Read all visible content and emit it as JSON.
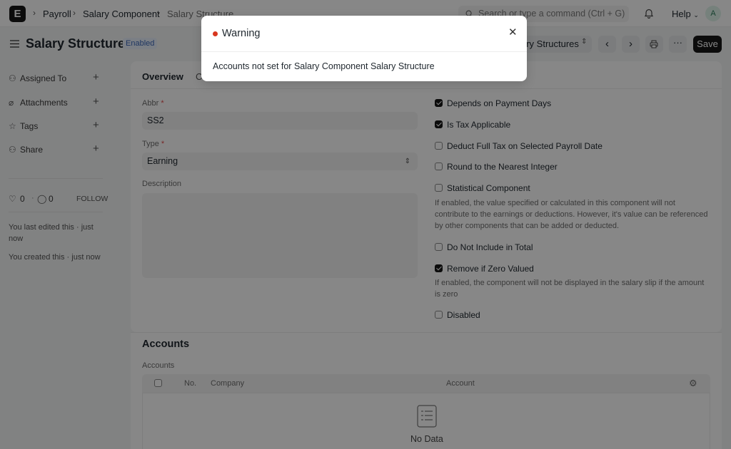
{
  "navbar": {
    "logo": "E",
    "breadcrumbs": [
      "Payroll",
      "Salary Component",
      "Salary Structure"
    ],
    "search_placeholder": "Search or type a command (Ctrl + G)",
    "help_label": "Help",
    "avatar_letter": "A"
  },
  "page": {
    "title": "Salary Structure",
    "status": "Enabled",
    "view_switch_label": "ary Structures",
    "save_label": "Save"
  },
  "sidebar": {
    "items": [
      {
        "label": "Assigned To"
      },
      {
        "label": "Attachments"
      },
      {
        "label": "Tags"
      },
      {
        "label": "Share"
      }
    ],
    "likes": "0",
    "comments": "0",
    "follow_label": "FOLLOW",
    "last_edited": "You last edited this · just now",
    "created": "You created this · just now"
  },
  "tabs": [
    "Overview",
    "C"
  ],
  "form": {
    "abbr_label": "Abbr",
    "abbr_value": "SS2",
    "type_label": "Type",
    "type_value": "Earning",
    "description_label": "Description",
    "checkboxes": [
      {
        "label": "Depends on Payment Days",
        "checked": true
      },
      {
        "label": "Is Tax Applicable",
        "checked": true
      },
      {
        "label": "Deduct Full Tax on Selected Payroll Date",
        "checked": false
      },
      {
        "label": "Round to the Nearest Integer",
        "checked": false
      },
      {
        "label": "Statistical Component",
        "checked": false
      },
      {
        "label": "Do Not Include in Total",
        "checked": false
      },
      {
        "label": "Remove if Zero Valued",
        "checked": true
      },
      {
        "label": "Disabled",
        "checked": false
      }
    ],
    "statistical_desc": "If enabled, the value specified or calculated in this component will not contribute to the earnings or deductions. However, it's value can be referenced by other components that can be added or deducted.",
    "zero_desc": "If enabled, the component will not be displayed in the salary slip if the amount is zero"
  },
  "accounts": {
    "section_title": "Accounts",
    "table_label": "Accounts",
    "columns": [
      "No.",
      "Company",
      "Account"
    ],
    "empty_text": "No Data"
  },
  "modal": {
    "title": "Warning",
    "message": "Accounts not set for Salary Component Salary Structure"
  },
  "colors": {
    "accent": "#171717",
    "warning_dot": "#d8371f",
    "badge_text": "#3b67b8"
  }
}
